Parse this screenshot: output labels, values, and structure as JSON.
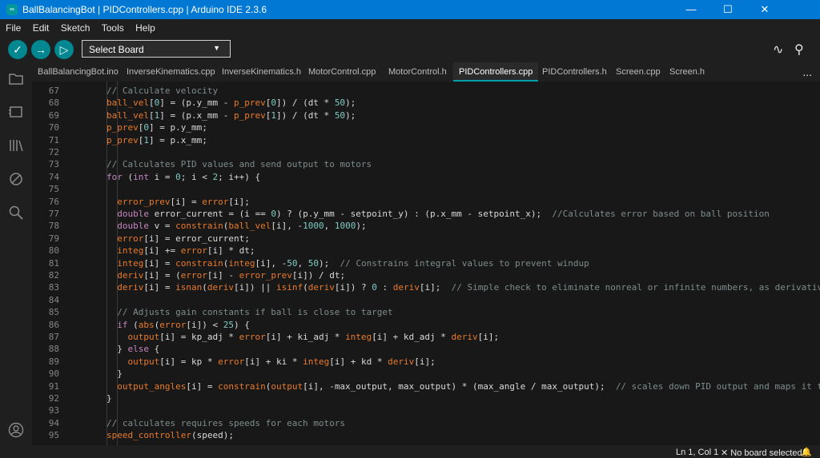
{
  "window": {
    "title": "BallBalancingBot | PIDControllers.cpp | Arduino IDE 2.3.6",
    "icon_name": "arduino-icon",
    "controls": [
      "minimize-icon",
      "maximize-icon",
      "close-icon"
    ]
  },
  "menu": [
    "File",
    "Edit",
    "Sketch",
    "Tools",
    "Help"
  ],
  "toolbar": {
    "verify_icon": "check-icon",
    "upload_icon": "arrow-right-icon",
    "debug_icon": "debug-icon",
    "board_select": "Select Board",
    "serial_plotter_icon": "serial-plotter-icon",
    "serial_monitor_icon": "serial-monitor-icon"
  },
  "tabs": [
    {
      "label": "BallBalancingBot.ino",
      "active": false
    },
    {
      "label": "InverseKinematics.cpp",
      "active": false
    },
    {
      "label": "InverseKinematics.h",
      "active": false
    },
    {
      "label": "MotorControl.cpp",
      "active": false
    },
    {
      "label": "MotorControl.h",
      "active": false
    },
    {
      "label": "PIDControllers.cpp",
      "active": true
    },
    {
      "label": "PIDControllers.h",
      "active": false
    },
    {
      "label": "Screen.cpp",
      "active": false
    },
    {
      "label": "Screen.h",
      "active": false
    }
  ],
  "tab_more": "...",
  "sidebar": {
    "items": [
      "folder-icon",
      "board-manager-icon",
      "library-icon",
      "debug-icon",
      "search-icon"
    ],
    "bottom": "account-icon"
  },
  "editor": {
    "lines": [
      {
        "n": "67",
        "text": "  // Calculate velocity"
      },
      {
        "n": "68",
        "text": "  ball_vel[0] = (p.y_mm - p_prev[0]) / (dt * 50);"
      },
      {
        "n": "69",
        "text": "  ball_vel[1] = (p.x_mm - p_prev[1]) / (dt * 50);"
      },
      {
        "n": "70",
        "text": "  p_prev[0] = p.y_mm;"
      },
      {
        "n": "71",
        "text": "  p_prev[1] = p.x_mm;"
      },
      {
        "n": "72",
        "text": ""
      },
      {
        "n": "73",
        "text": "  // Calculates PID values and send output to motors"
      },
      {
        "n": "74",
        "text": "  for (int i = 0; i < 2; i++) {"
      },
      {
        "n": "75",
        "text": ""
      },
      {
        "n": "76",
        "text": "    error_prev[i] = error[i];"
      },
      {
        "n": "77",
        "text": "    double error_current = (i == 0) ? (p.y_mm - setpoint_y) : (p.x_mm - setpoint_x);  //Calculates error based on ball position"
      },
      {
        "n": "78",
        "text": "    double v = constrain(ball_vel[i], -1000, 1000);"
      },
      {
        "n": "79",
        "text": "    error[i] = error_current;"
      },
      {
        "n": "80",
        "text": "    integ[i] += error[i] * dt;"
      },
      {
        "n": "81",
        "text": "    integ[i] = constrain(integ[i], -50, 50);  // Constrains integral values to prevent windup"
      },
      {
        "n": "82",
        "text": "    deriv[i] = (error[i] - error_prev[i]) / dt;"
      },
      {
        "n": "83",
        "text": "    deriv[i] = isnan(deriv[i]) || isinf(deriv[i]) ? 0 : deriv[i];  // Simple check to eliminate nonreal or infinite numbers, as derivative is bei"
      },
      {
        "n": "84",
        "text": ""
      },
      {
        "n": "85",
        "text": "    // Adjusts gain constants if ball is close to target"
      },
      {
        "n": "86",
        "text": "    if (abs(error[i]) < 25) {"
      },
      {
        "n": "87",
        "text": "      output[i] = kp_adj * error[i] + ki_adj * integ[i] + kd_adj * deriv[i];"
      },
      {
        "n": "88",
        "text": "    } else {"
      },
      {
        "n": "89",
        "text": "      output[i] = kp * error[i] + ki * integ[i] + kd * deriv[i];"
      },
      {
        "n": "90",
        "text": "    }"
      },
      {
        "n": "91",
        "text": "    output_angles[i] = constrain(output[i], -max_output, max_output) * (max_angle / max_output);  // scales down PID output and maps it to an ang"
      },
      {
        "n": "92",
        "text": "  }"
      },
      {
        "n": "93",
        "text": ""
      },
      {
        "n": "94",
        "text": "  // calculates requires speeds for each motors"
      },
      {
        "n": "95",
        "text": "  speed_controller(speed);"
      }
    ]
  },
  "status": {
    "position": "Ln 1, Col 1",
    "board_icon": "close-icon",
    "board": "No board selected",
    "notification_icon": "bell-icon"
  },
  "colors": {
    "titlebar": "#0078d4",
    "accent": "#00878f",
    "active_tab_underline": "#00a0a8",
    "comment": "#7f8c8d",
    "keyword": "#c586c0",
    "function": "#e97a2a",
    "number": "#7fcac3"
  }
}
